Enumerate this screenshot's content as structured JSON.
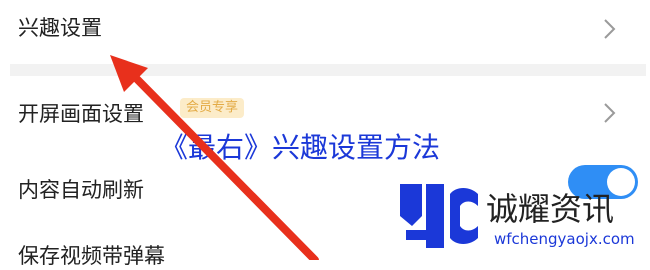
{
  "settings": {
    "interest_settings": "兴趣设置",
    "splash_settings": "开屏画面设置",
    "vip_badge": "会员专享",
    "auto_refresh": "内容自动刷新",
    "auto_refresh_enabled": true,
    "cut_off_row": "保存视频带弹幕"
  },
  "overlay": {
    "title": "《最右》兴趣设置方法"
  },
  "watermark": {
    "name": "诚耀资讯",
    "url": "wfchengyaojx.com"
  },
  "colors": {
    "accent_blue": "#1b38d8",
    "arrow_red": "#e8301c",
    "toggle_on": "#2f8ef5",
    "badge_text": "#e3ab46"
  }
}
